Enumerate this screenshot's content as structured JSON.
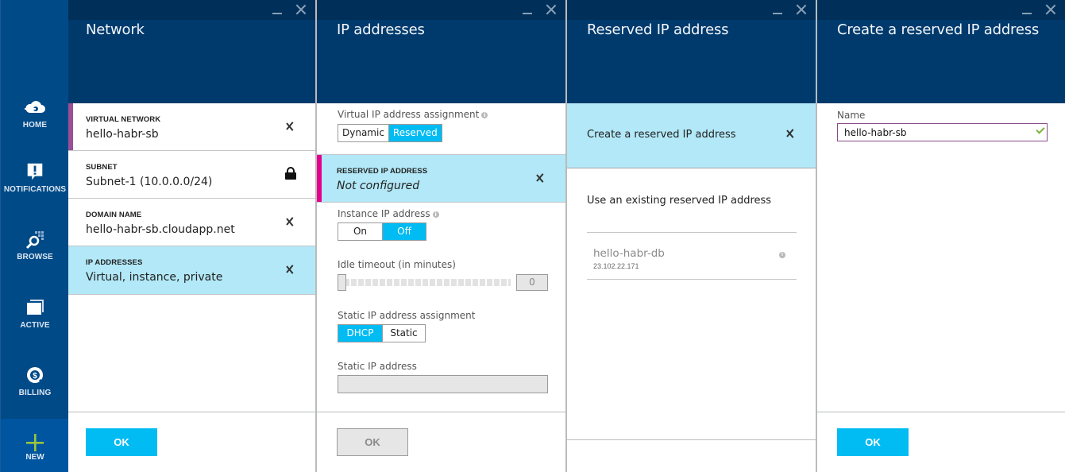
{
  "sidebar": {
    "items": [
      {
        "label": "HOME",
        "icon": "cloud-home-icon"
      },
      {
        "label": "NOTIFICATIONS",
        "icon": "notification-bubble-icon"
      },
      {
        "label": "BROWSE",
        "icon": "browse-grid-search-icon"
      },
      {
        "label": "ACTIVE",
        "icon": "active-windows-icon"
      },
      {
        "label": "BILLING",
        "icon": "billing-dollar-icon"
      }
    ],
    "new": {
      "label": "NEW",
      "icon": "plus-icon",
      "color": "#9bc53d"
    }
  },
  "colors": {
    "accent": "#00bcf2",
    "header_bg": "#003a6c",
    "selected_bg": "#b2e8f7",
    "sidebar_bg": "#004a87",
    "virtual_network_accent": "#9b4f96",
    "reserved_ip_accent": "#e3008c"
  },
  "panes": {
    "network": {
      "title": "Network",
      "items": [
        {
          "caption": "VIRTUAL NETWORK",
          "value": "hello-habr-sb",
          "icon": "chevron-right-icon"
        },
        {
          "caption": "SUBNET",
          "value": "Subnet-1 (10.0.0.0/24)",
          "icon": "lock-icon"
        },
        {
          "caption": "DOMAIN NAME",
          "value": "hello-habr-sb.cloudapp.net",
          "icon": "chevron-right-icon"
        },
        {
          "caption": "IP ADDRESSES",
          "value": "Virtual, instance, private",
          "icon": "chevron-right-icon",
          "selected": true
        }
      ],
      "ok_label": "OK"
    },
    "ip_addresses": {
      "title": "IP addresses",
      "virtual_ip_label": "Virtual IP address assignment",
      "virtual_ip_options": [
        "Dynamic",
        "Reserved"
      ],
      "virtual_ip_selected": "Reserved",
      "reserved_ip_caption": "RESERVED IP ADDRESS",
      "reserved_ip_value": "Not configured",
      "instance_ip_label": "Instance IP address",
      "instance_ip_options": [
        "On",
        "Off"
      ],
      "instance_ip_selected": "Off",
      "idle_timeout_label": "Idle timeout (in minutes)",
      "idle_timeout_value": "0",
      "static_assign_label": "Static IP address assignment",
      "static_assign_options": [
        "DHCP",
        "Static"
      ],
      "static_assign_selected": "DHCP",
      "static_ip_label": "Static IP address",
      "static_ip_value": "",
      "ok_label": "OK"
    },
    "reserved_ip": {
      "title": "Reserved IP address",
      "create_label": "Create a reserved IP address",
      "existing_header": "Use an existing reserved IP address",
      "existing": [
        {
          "name": "hello-habr-db",
          "ip": "23.102.22.171"
        }
      ]
    },
    "create_reserved": {
      "title": "Create a reserved IP address",
      "name_label": "Name",
      "name_value": "hello-habr-sb",
      "ok_label": "OK"
    }
  }
}
